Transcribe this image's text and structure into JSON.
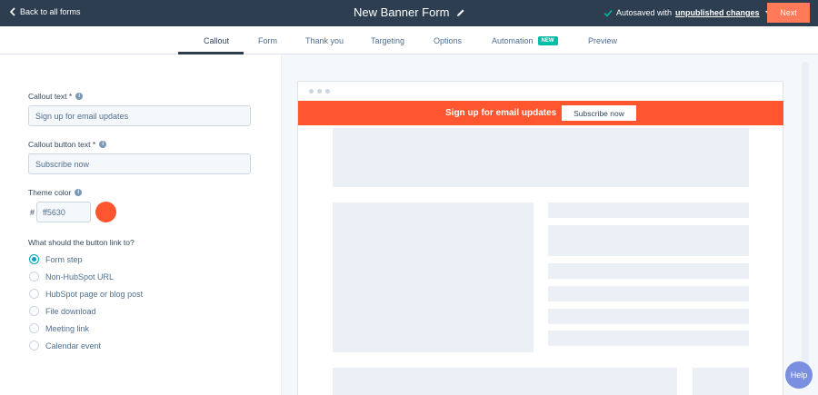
{
  "topbar": {
    "back_label": "Back to all forms",
    "form_title": "New Banner Form",
    "autosave_prefix": "Autosaved with",
    "autosave_link": "unpublished changes",
    "next_label": "Next"
  },
  "tabs": [
    {
      "label": "Callout",
      "active": true
    },
    {
      "label": "Form"
    },
    {
      "label": "Thank you"
    },
    {
      "label": "Targeting"
    },
    {
      "label": "Options"
    },
    {
      "label": "Automation",
      "badge": "NEW"
    },
    {
      "label": "Preview"
    }
  ],
  "form": {
    "callout_text_label": "Callout text *",
    "callout_text_value": "Sign up for email updates",
    "callout_button_label": "Callout button text *",
    "callout_button_value": "Subscribe now",
    "theme_color_label": "Theme color",
    "hash": "#",
    "theme_color_value": "ff5630",
    "theme_color_hex": "#ff5630",
    "link_question": "What should the button link to?",
    "link_options": [
      {
        "label": "Form step",
        "checked": true
      },
      {
        "label": "Non-HubSpot URL",
        "checked": false
      },
      {
        "label": "HubSpot page or blog post",
        "checked": false
      },
      {
        "label": "File download",
        "checked": false
      },
      {
        "label": "Meeting link",
        "checked": false
      },
      {
        "label": "Calendar event",
        "checked": false
      }
    ]
  },
  "preview": {
    "banner_text": "Sign up for email updates",
    "banner_button": "Subscribe now",
    "banner_color": "#ff5630"
  },
  "help_label": "Help",
  "icons": {
    "back": "chevron-left-icon",
    "edit": "pencil-icon",
    "autosave": "check-icon",
    "info": "info-icon"
  }
}
